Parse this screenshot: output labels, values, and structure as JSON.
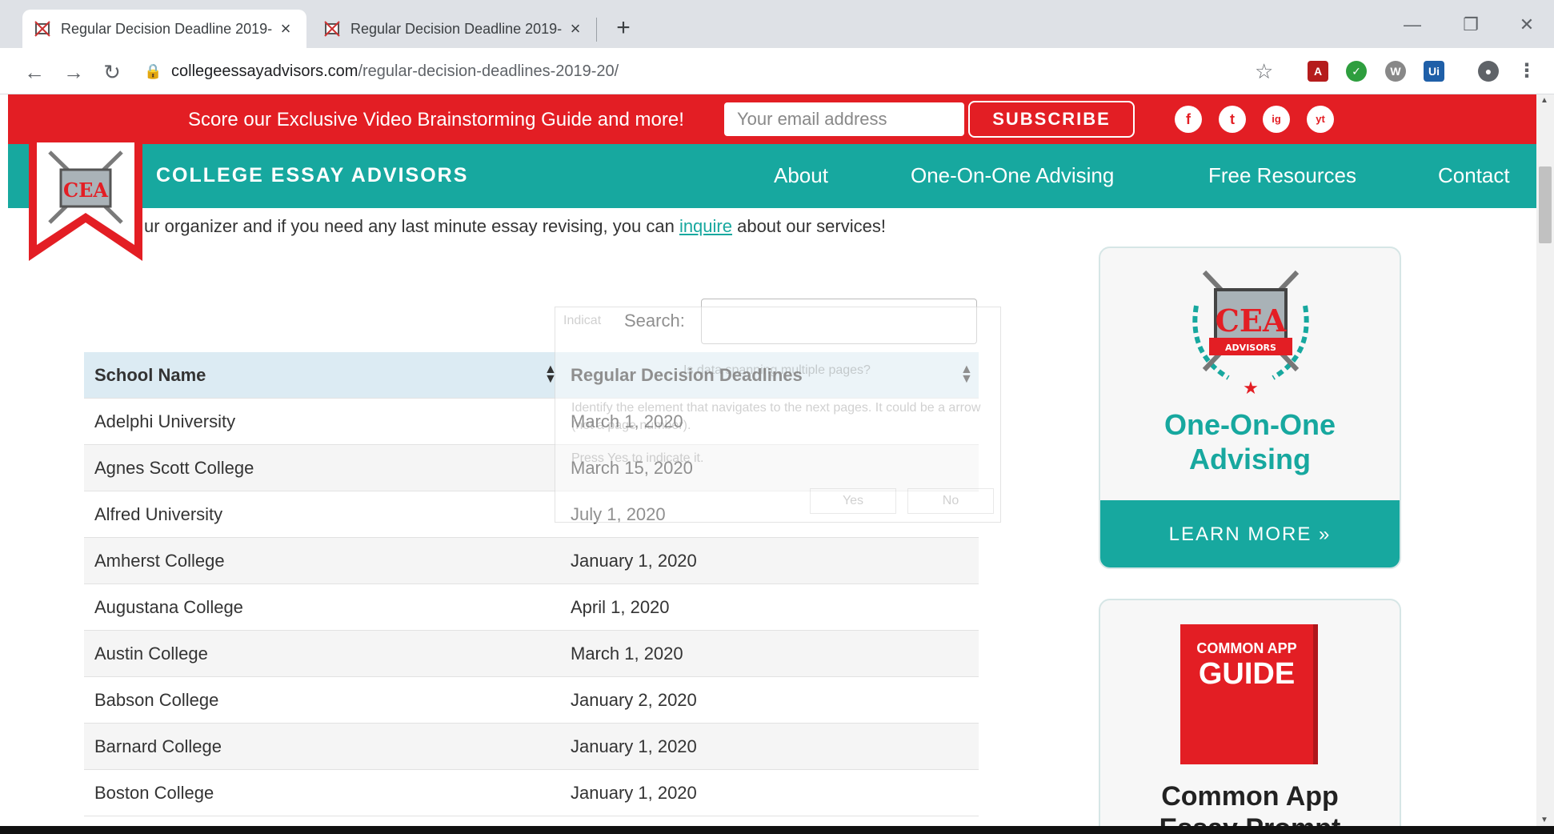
{
  "browser": {
    "tabs": [
      {
        "title": "Regular Decision Deadline 2019-",
        "active": true
      },
      {
        "title": "Regular Decision Deadline 2019-",
        "active": false
      }
    ],
    "new_tab": "+",
    "window_controls": {
      "minimize": "—",
      "restore": "❐",
      "close": "✕"
    },
    "nav": {
      "back": "←",
      "forward": "→",
      "reload": "↻"
    },
    "url_host": "collegeessayadvisors.com",
    "url_path": "/regular-decision-deadlines-2019-20/",
    "extensions": [
      "pdf-extension-icon",
      "check-extension-icon",
      "w-extension-icon",
      "ui-extension-icon",
      "profile-icon",
      "menu-icon"
    ]
  },
  "promo": {
    "text": "Score our Exclusive Video Brainstorming Guide and more!",
    "email_placeholder": "Your email address",
    "subscribe_label": "SUBSCRIBE",
    "social": [
      "f",
      "t",
      "ig",
      "yt"
    ]
  },
  "navbar": {
    "brand": "COLLEGE ESSAY ADVISORS",
    "links": [
      "About",
      "One-On-One Advising",
      "Free Resources",
      "Contact"
    ]
  },
  "logo_text": "CEA",
  "intro": {
    "before": "ur organizer and if you need any last minute essay revising, you can ",
    "link": "inquire",
    "after": " about our services!"
  },
  "search": {
    "label": "Search:",
    "value": ""
  },
  "table": {
    "headers": [
      "School Name",
      "Regular Decision Deadlines"
    ],
    "rows": [
      [
        "Adelphi University",
        "March 1, 2020"
      ],
      [
        "Agnes Scott College",
        "March 15, 2020"
      ],
      [
        "Alfred University",
        "July 1, 2020"
      ],
      [
        "Amherst College",
        "January 1, 2020"
      ],
      [
        "Augustana College",
        "April 1, 2020"
      ],
      [
        "Austin College",
        "March 1, 2020"
      ],
      [
        "Babson College",
        "January 2, 2020"
      ],
      [
        "Barnard College",
        "January 1, 2020"
      ],
      [
        "Boston College",
        "January 1, 2020"
      ]
    ]
  },
  "overlay": {
    "title": "Indicat",
    "question": "Is data spanning multiple pages?",
    "body": "Identify the element that navigates to the next pages. It could be a arrow (not a page number).",
    "hint": "Press Yes to indicate it.",
    "yes": "Yes",
    "no": "No"
  },
  "sidebar": {
    "card1": {
      "badge_text": "CEA",
      "badge_ribbon": "ADVISORS",
      "title_line1": "One-On-One",
      "title_line2": "Advising",
      "button": "LEARN MORE »"
    },
    "card2": {
      "book_line1": "COMMON APP",
      "book_line2": "GUIDE",
      "title_line1": "Common App",
      "title_line2": "Essay Prompt"
    }
  },
  "colors": {
    "red": "#e31e24",
    "teal": "#17a89f",
    "header_row": "#dcebf3"
  }
}
